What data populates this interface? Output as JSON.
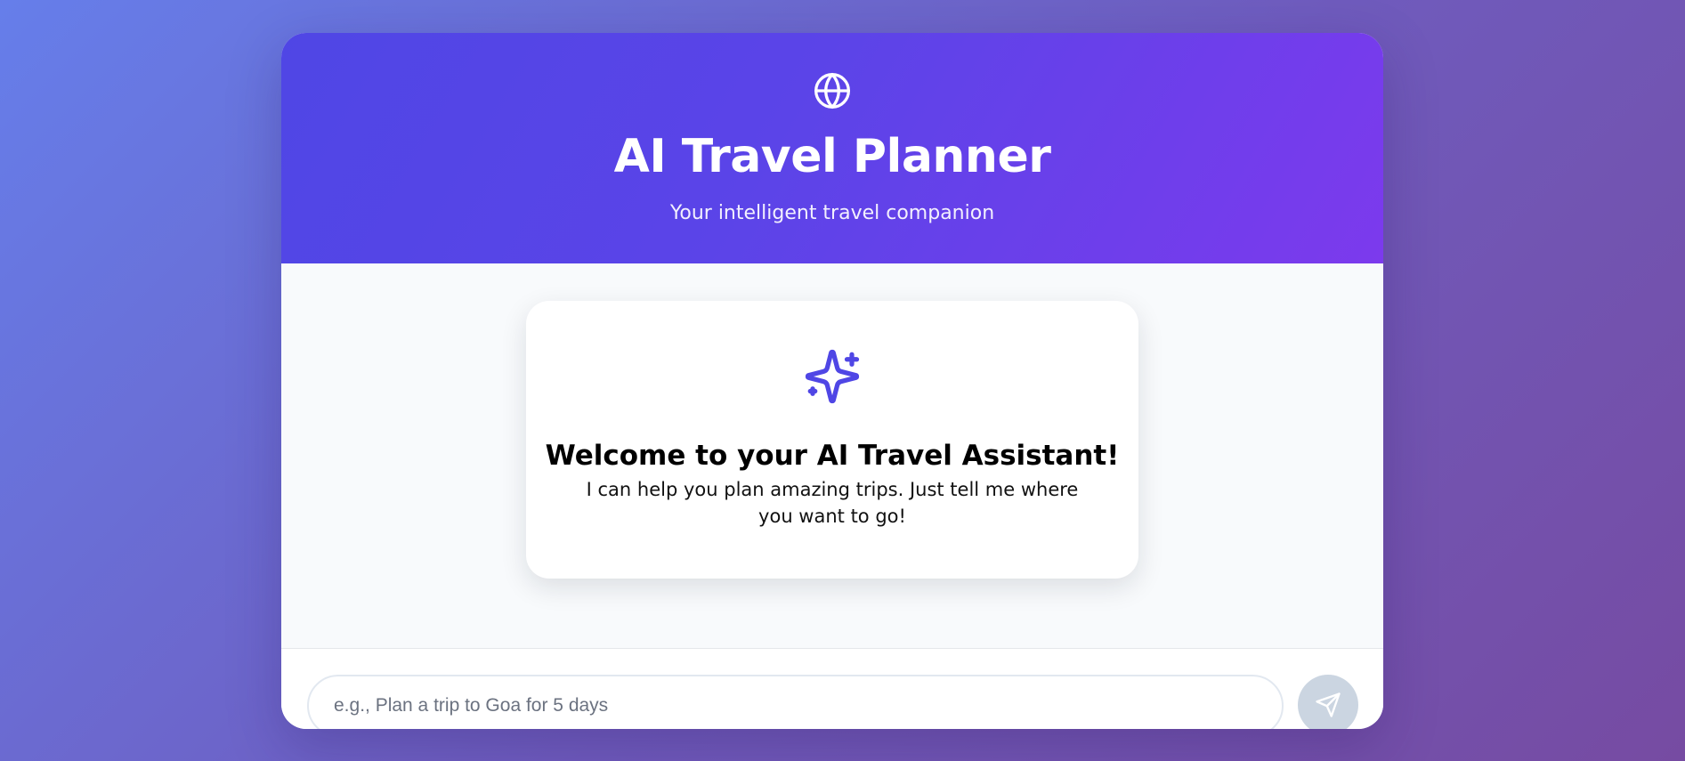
{
  "app": {
    "title": "AI Travel Planner",
    "subtitle": "Your intelligent travel companion",
    "header_icon": "globe-icon"
  },
  "welcome": {
    "icon": "sparkle-icon",
    "title": "Welcome to your AI Travel Assistant!",
    "text": "I can help you plan amazing trips. Just tell me where you want to go!"
  },
  "composer": {
    "placeholder": "e.g., Plan a trip to Goa for 5 days",
    "value": "",
    "send_icon": "send-icon"
  },
  "colors": {
    "background_start": "#667eea",
    "background_end": "#764ba2",
    "header_start": "#4f46e5",
    "header_end": "#7c3aed",
    "accent": "#4f46e5",
    "send_button": "#cbd5e1"
  }
}
